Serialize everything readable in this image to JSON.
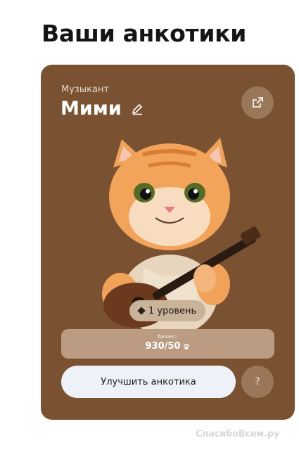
{
  "page": {
    "title": "Ваши анкотики"
  },
  "card": {
    "role": "Музыкант",
    "name": "Мими",
    "level": "1 уровень",
    "balance": {
      "label": "баланс:",
      "value": "930/50"
    },
    "upgrade_label": "Улучшить анкотика",
    "help_label": "?"
  },
  "icons": [
    "edit-icon",
    "share-icon",
    "diamond-icon",
    "paw-icon",
    "cat-guitar-illustration"
  ],
  "colors": {
    "card_bg": "#7a5232",
    "button_bg": "#eef2f8",
    "balance_bg": "#bb9c82",
    "badge_bg": "#c9b39a"
  },
  "watermark": "СпасибоВсем.ру"
}
